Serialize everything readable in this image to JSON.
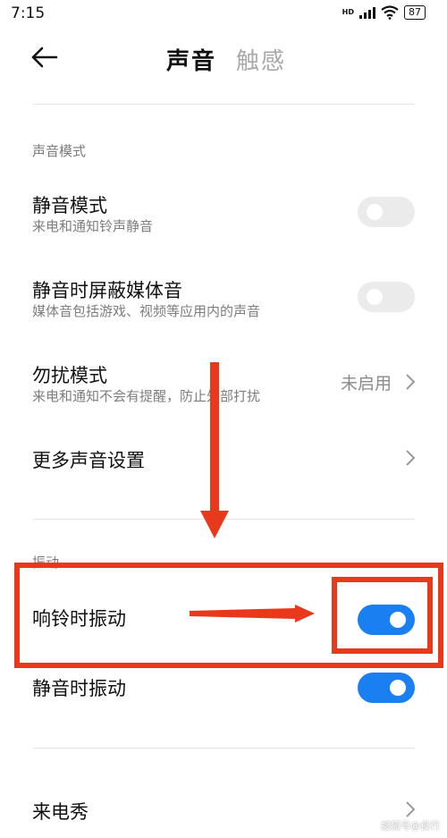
{
  "status_bar": {
    "time": "7:15",
    "network": "HD",
    "battery": "87"
  },
  "header": {
    "back_icon": "arrow-left-icon",
    "tabs": [
      {
        "label": "声音",
        "active": true
      },
      {
        "label": "触感",
        "active": false
      }
    ]
  },
  "sections": {
    "sound_mode": {
      "label": "声音模式",
      "items": [
        {
          "title": "静音模式",
          "subtitle": "来电和通知铃声静音",
          "toggle": false
        },
        {
          "title": "静音时屏蔽媒体音",
          "subtitle": "媒体音包括游戏、视频等应用内的声音",
          "toggle": false
        },
        {
          "title": "勿扰模式",
          "subtitle": "来电和通知不会有提醒，防止外部打扰",
          "value": "未启用"
        },
        {
          "title": "更多声音设置"
        }
      ]
    },
    "vibration": {
      "label": "振动",
      "items": [
        {
          "title": "响铃时振动",
          "toggle": true
        },
        {
          "title": "静音时振动",
          "toggle": true
        }
      ]
    },
    "caller_show": {
      "title": "来电秀"
    }
  },
  "colors": {
    "toggle_on": "#1a7ff0",
    "toggle_off": "#ebebeb",
    "annotation": "#e8391d"
  },
  "watermark": "搜狐号@良行"
}
